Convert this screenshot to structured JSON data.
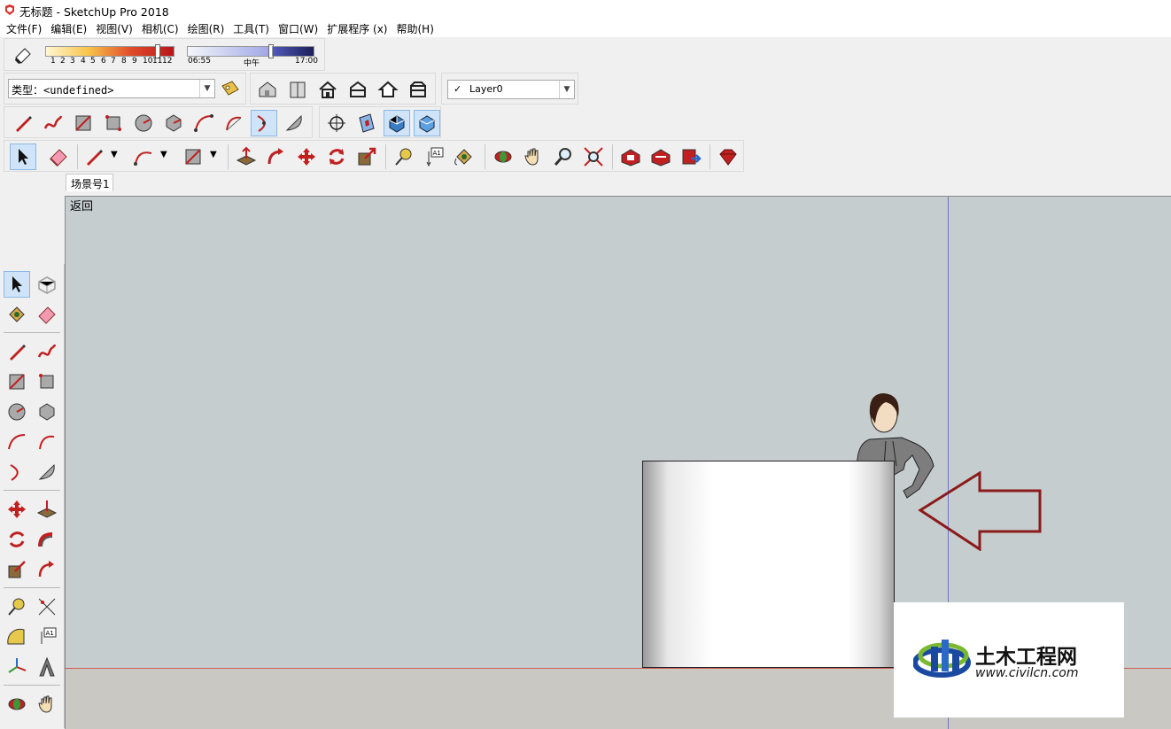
{
  "window": {
    "title": "无标题 - SketchUp Pro 2018"
  },
  "menu": [
    "文件(F)",
    "编辑(E)",
    "视图(V)",
    "相机(C)",
    "绘图(R)",
    "工具(T)",
    "窗口(W)",
    "扩展程序 (x)",
    "帮助(H)"
  ],
  "shadow": {
    "months": [
      "1",
      "2",
      "3",
      "4",
      "5",
      "6",
      "7",
      "8",
      "9",
      "10",
      "11",
      "12"
    ],
    "time_start": "06:55",
    "time_mid": "中午",
    "time_end": "17:00"
  },
  "classifier": {
    "type_value": "类型：<undefined>"
  },
  "layers": {
    "current": "Layer0",
    "check": "✓"
  },
  "scene": {
    "tab": "场景号1"
  },
  "viewport": {
    "back_label": "返回"
  },
  "watermark": {
    "brand": "土木工程网",
    "url": "www.civilcn.com"
  },
  "colors": {
    "accent": "#8b1a1a",
    "sky": "#c6cdce",
    "ground": "#c9c8c2",
    "blue_axis": "#6f76c6",
    "red_axis": "#cf5b55"
  }
}
